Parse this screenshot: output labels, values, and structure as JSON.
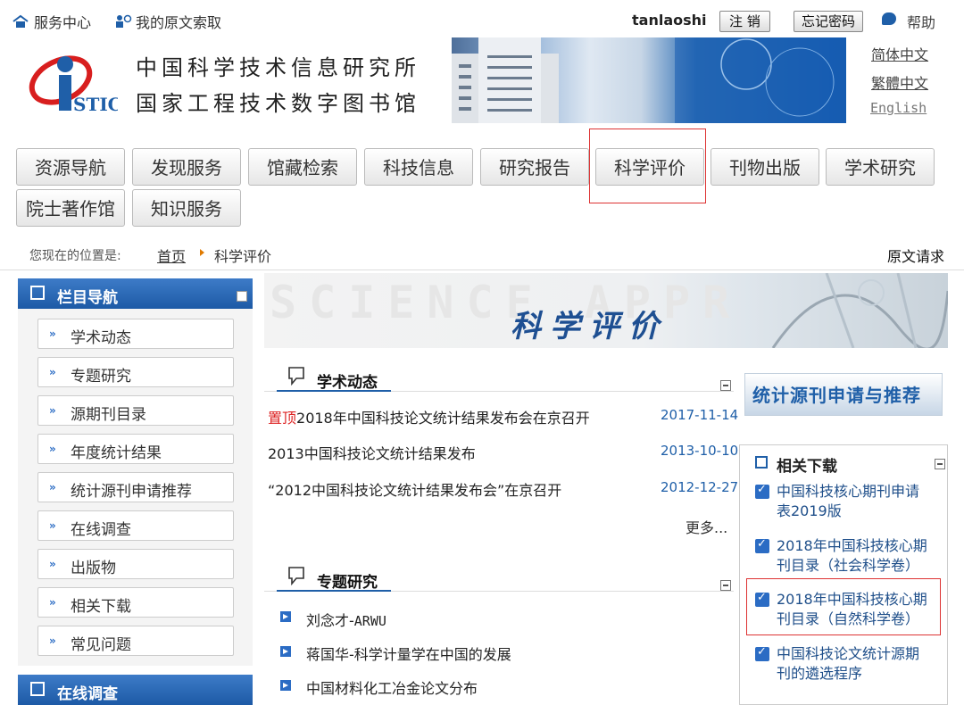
{
  "topbar": {
    "service_center": "服务中心",
    "my_requests": "我的原文索取",
    "username": "tanlaoshi",
    "logout": "注 销",
    "forgot_password": "忘记密码",
    "help": "帮助"
  },
  "header": {
    "logo_text": "STIC",
    "inst_name_1": "中国科学技术信息研究所",
    "inst_name_2": "国家工程技术数字图书馆",
    "lang_simplified": "简体中文",
    "lang_traditional": "繁體中文",
    "lang_english": "English"
  },
  "nav": {
    "items": [
      "资源导航",
      "发现服务",
      "馆藏检索",
      "科技信息",
      "研究报告",
      "科学评价",
      "刊物出版",
      "学术研究",
      "院士著作馆",
      "知识服务"
    ]
  },
  "breadcrumb": {
    "label": "您现在的位置是:",
    "home": "首页",
    "current": "科学评价",
    "request": "原文请求"
  },
  "sidebar": {
    "title": "栏目导航",
    "items": [
      "学术动态",
      "专题研究",
      "源期刊目录",
      "年度统计结果",
      "统计源刊申请推荐",
      "在线调查",
      "出版物",
      "相关下载",
      "常见问题"
    ],
    "title2": "在线调查"
  },
  "banner": {
    "faint_text": "SCIENCE APPR",
    "title": "科学评价"
  },
  "news": {
    "title": "学术动态",
    "items": [
      {
        "pin": "置顶",
        "text": "2018年中国科技论文统计结果发布会在京召开",
        "date": "2017-11-14"
      },
      {
        "pin": "",
        "text": "2013中国科技论文统计结果发布",
        "date": "2013-10-10"
      },
      {
        "pin": "",
        "text": "“2012中国科技论文统计结果发布会”在京召开",
        "date": "2012-12-27"
      }
    ],
    "more": "更多..."
  },
  "topics": {
    "title": "专题研究",
    "items": [
      {
        "a": "刘念才-",
        "b": "ARWU"
      },
      {
        "a": "蒋国华-科学计量学在中国的发展",
        "b": ""
      },
      {
        "a": "中国材料化工冶金论文分布",
        "b": ""
      }
    ]
  },
  "right": {
    "promo": "统计源刊申请与推荐",
    "downloads_title": "相关下载",
    "downloads": [
      {
        "l1": "中国科技核心期刊申请",
        "l2": "表2019版"
      },
      {
        "l1": "2018年中国科技核心期",
        "l2": "刊目录（社会科学卷）"
      },
      {
        "l1": "2018年中国科技核心期",
        "l2": "刊目录（自然科学卷）"
      },
      {
        "l1": "中国科技论文统计源期",
        "l2": "刊的遴选程序"
      }
    ]
  }
}
